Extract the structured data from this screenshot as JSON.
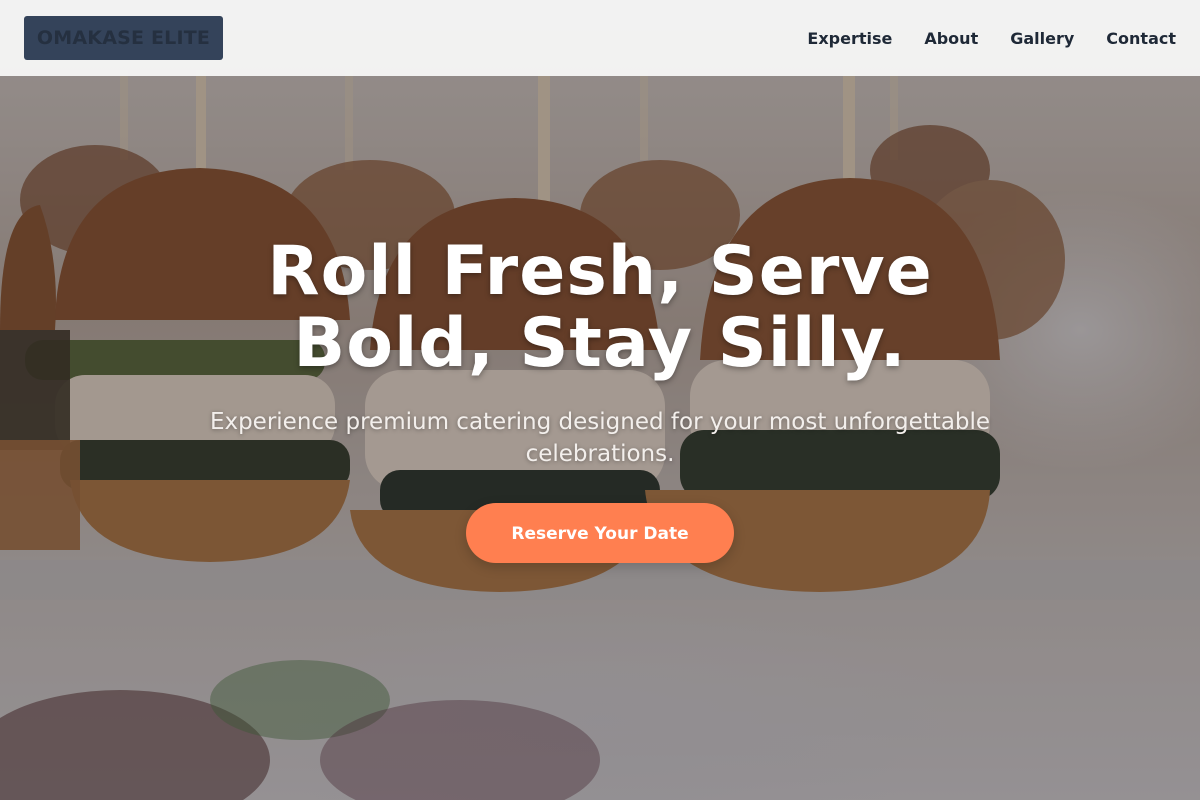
{
  "navbar": {
    "logo": "OMAKASE ELITE",
    "links": [
      "Expertise",
      "About",
      "Gallery",
      "Contact"
    ]
  },
  "hero": {
    "title": "Roll Fresh, Serve Bold, Stay Silly.",
    "subtitle": "Experience premium catering designed for your most unforgettable celebrations.",
    "cta_label": "Reserve Your Date",
    "background_image": "sliders-on-skewers-photo"
  },
  "colors": {
    "navbar_bg": "#f6f6f6",
    "logo_bg": "#34435a",
    "nav_text": "#1f2937",
    "cta_bg": "#ff7f50",
    "cta_text": "#ffffff",
    "hero_text": "#ffffff"
  }
}
